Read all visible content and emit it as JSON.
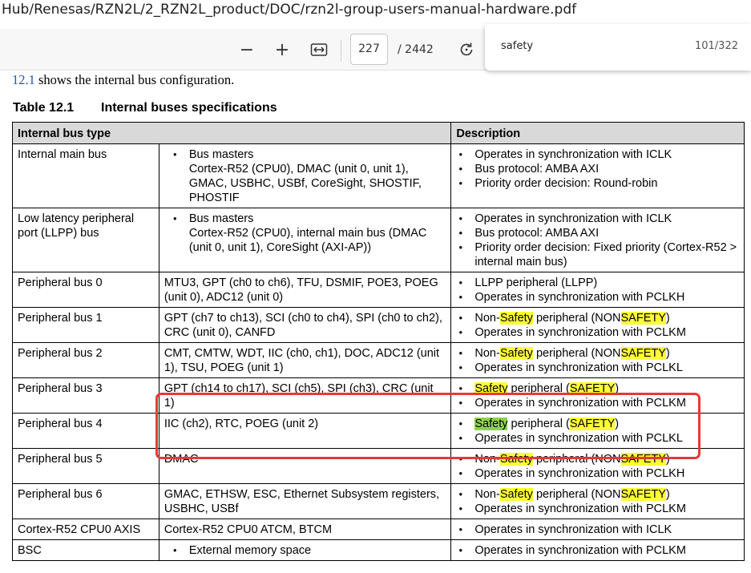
{
  "address": {
    "text": "Hub/Renesas/RZN2L/2_RZN2L_product/DOC/rzn2l-group-users-manual-hardware.pdf"
  },
  "toolbar": {
    "zoom_out": "−",
    "zoom_in": "+",
    "page": "227",
    "page_total": "/ 2442"
  },
  "find": {
    "query": "safety",
    "count": "101/322"
  },
  "doc": {
    "intro_ref": "12.1",
    "intro_text": " shows the internal bus configuration.",
    "table_number": "Table 12.1",
    "table_title": "Internal buses specifications"
  },
  "table": {
    "headers": [
      "Internal bus type",
      "Description"
    ],
    "rows": [
      {
        "type": "Internal main bus",
        "bullet": "Bus masters",
        "detail": "Cortex-R52 (CPU0), DMAC (unit 0, unit 1), GMAC, USBHC, USBf, CoreSight, SHOSTIF, PHOSTIF",
        "desc": [
          "Operates in synchronization with ICLK",
          "Bus protocol: AMBA AXI",
          "Priority order decision: Round-robin"
        ]
      },
      {
        "type": "Low latency peripheral port (LLPP) bus",
        "bullet": "Bus masters",
        "detail": "Cortex-R52 (CPU0), internal main bus (DMAC (unit 0, unit 1), CoreSight (AXI-AP))",
        "desc": [
          "Operates in synchronization with ICLK",
          "Bus protocol: AMBA AXI",
          "Priority order decision: Fixed priority (Cortex-R52 > internal main bus)"
        ]
      },
      {
        "type": "Peripheral bus 0",
        "detail": "MTU3, GPT (ch0 to ch6), TFU, DSMIF, POE3, POEG (unit 0), ADC12 (unit 0)",
        "desc": [
          "LLPP peripheral (LLPP)",
          "Operates in synchronization with PCLKH"
        ]
      },
      {
        "type": "Peripheral bus 1",
        "detail": "GPT (ch7 to ch13), SCI (ch0 to ch4), SPI (ch0 to ch2), CRC (unit 0), CANFD",
        "desc_a": "Non-",
        "desc_hl": "Safety",
        "desc_b": " peripheral (NON",
        "desc_hl2": "SAFETY",
        "desc_c": ")",
        "desc2": "Operates in synchronization with PCLKM"
      },
      {
        "type": "Peripheral bus 2",
        "detail": "CMT, CMTW, WDT, IIC (ch0, ch1), DOC, ADC12 (unit 1), TSU, POEG (unit 1)",
        "desc_a": "Non-",
        "desc_hl": "Safety",
        "desc_b": " peripheral (NON",
        "desc_hl2": "SAFETY",
        "desc_c": ")",
        "desc2": "Operates in synchronization with PCLKL"
      },
      {
        "type": "Peripheral bus 3",
        "detail": "GPT (ch14 to ch17), SCI (ch5), SPI (ch3), CRC (unit 1)",
        "desc_hl": "Safety",
        "desc_b": " peripheral (",
        "desc_hl2": "SAFETY",
        "desc_c": ")",
        "desc2": "Operates in synchronization with PCLKM"
      },
      {
        "type": "Peripheral bus 4",
        "detail": "IIC (ch2), RTC, POEG (unit 2)",
        "desc_hl": "Safety",
        "desc_b": " peripheral (",
        "desc_hl2": "SAFETY",
        "desc_c": ")",
        "desc2": "Operates in synchronization with PCLKL"
      },
      {
        "type": "Peripheral bus 5",
        "detail": "DMAC",
        "desc_a": "Non-",
        "desc_hl": "Safety",
        "desc_b": " peripheral (NON",
        "desc_hl2": "SAFETY",
        "desc_c": ")",
        "desc2": "Operates in synchronization with PCLKH"
      },
      {
        "type": "Peripheral bus 6",
        "detail": "GMAC, ETHSW, ESC, Ethernet Subsystem registers, USBHC, USBf",
        "desc_a": "Non-",
        "desc_hl": "Safety",
        "desc_b": " peripheral (NON",
        "desc_hl2": "SAFETY",
        "desc_c": ")",
        "desc2": "Operates in synchronization with PCLKM"
      },
      {
        "type": "Cortex-R52 CPU0 AXIS",
        "detail": "Cortex-R52 CPU0 ATCM, BTCM",
        "desc": [
          "Operates in synchronization with ICLK"
        ]
      },
      {
        "type": "BSC",
        "bullet": "External memory space",
        "desc": [
          "Operates in synchronization with PCLKM"
        ]
      }
    ]
  },
  "colors": {
    "highlight": "#ffff33",
    "current_match": "#8fd14f",
    "annotation": "#e53935"
  }
}
